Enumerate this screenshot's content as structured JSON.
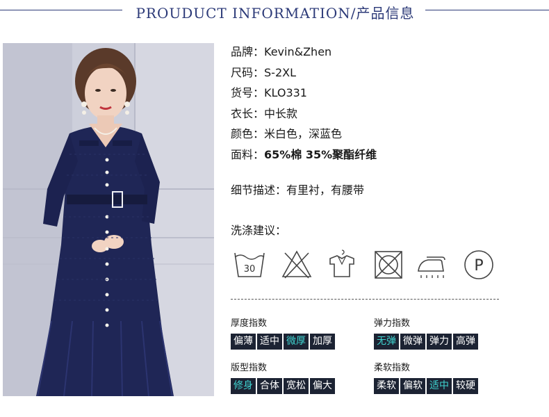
{
  "header": {
    "title": "PROUDUCT INFORMATION/产品信息"
  },
  "info": [
    {
      "key": "品牌：",
      "value": "Kevin&Zhen",
      "bold": false
    },
    {
      "key": "尺码：",
      "value": "S-2XL",
      "bold": false
    },
    {
      "key": "货号：",
      "value": "KLO331",
      "bold": false
    },
    {
      "key": "衣长：",
      "value": "中长款",
      "bold": false
    },
    {
      "key": "颜色：",
      "value": "米白色，深蓝色",
      "bold": false
    },
    {
      "key": "面料：",
      "value": "65%棉 35%聚酯纤维",
      "bold": true
    }
  ],
  "detail": {
    "label": "细节描述：",
    "value": "有里衬，有腰带"
  },
  "wash": {
    "title": "洗涤建议：",
    "icons": [
      {
        "name": "wash-30-icon",
        "text": "30"
      },
      {
        "name": "no-bleach-icon",
        "text": ""
      },
      {
        "name": "hang-dry-icon",
        "text": ""
      },
      {
        "name": "no-tumble-dry-icon",
        "text": ""
      },
      {
        "name": "iron-icon",
        "text": ""
      },
      {
        "name": "dry-clean-icon",
        "text": "P"
      }
    ]
  },
  "indices": [
    {
      "label": "厚度指数",
      "options": [
        "偏薄",
        "适中",
        "微厚",
        "加厚"
      ],
      "active": 2
    },
    {
      "label": "弹力指数",
      "options": [
        "无弹",
        "微弹",
        "弹力",
        "高弹"
      ],
      "active": 0
    },
    {
      "label": "版型指数",
      "options": [
        "修身",
        "合体",
        "宽松",
        "偏大"
      ],
      "active": 0
    },
    {
      "label": "柔软指数",
      "options": [
        "柔软",
        "偏软",
        "适中",
        "较硬"
      ],
      "active": 2
    }
  ],
  "colors": {
    "accent": "#2c3a78",
    "indexBg": "#1c2333",
    "indexActive": "#3fd3d0",
    "dress": "#1f2656"
  }
}
